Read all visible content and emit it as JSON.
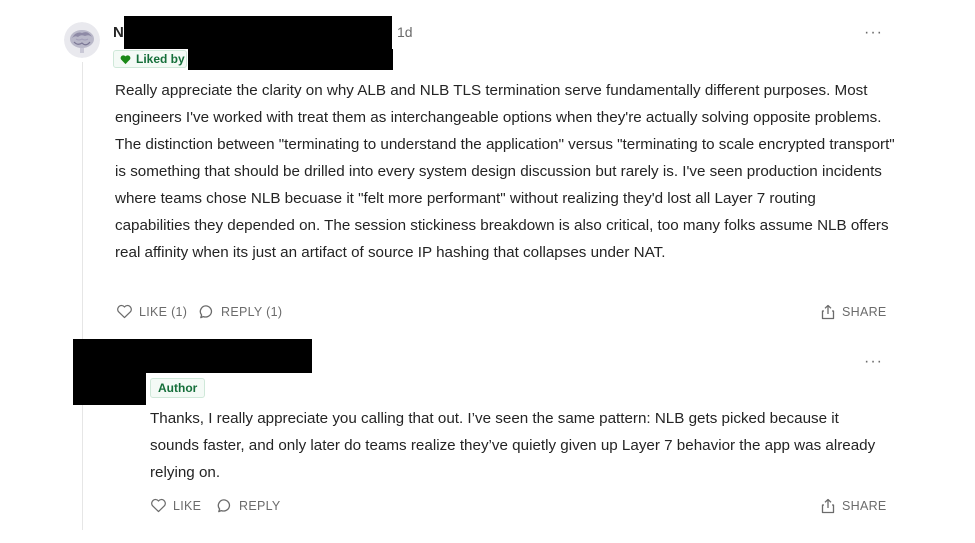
{
  "comment": {
    "author_initial": "N",
    "timestamp": "1d",
    "more_label": "···",
    "liked_by_label": "Liked by",
    "body": "Really appreciate the clarity on why ALB and NLB TLS termination serve fundamentally different purposes. Most engineers I've worked with treat them as interchangeable options when they're actually solving opposite problems. The distinction between \"terminating to understand the application\" versus \"terminating to scale encrypted transport\" is something that should be drilled into every system design discussion but rarely is. I've seen production incidents where teams chose NLB becuase it \"felt more performant\" without realizing they'd lost all Layer 7 routing capabilities they depended on. The session stickiness breakdown is also critical, too many folks assume NLB offers real affinity when its just an artifact of source IP hashing that collapses under NAT.",
    "like_label": "LIKE (1)",
    "reply_label": "REPLY (1)",
    "share_label": "SHARE"
  },
  "reply": {
    "more_label": "···",
    "author_badge": "Author",
    "body": "Thanks, I really appreciate you calling that out. I’ve seen the same pattern: NLB gets picked because it sounds faster, and only later do teams realize they’ve quietly given up Layer 7 behavior the app was already relying on.",
    "like_label": "LIKE",
    "reply_label": "REPLY",
    "share_label": "SHARE"
  },
  "colors": {
    "text": "#242424",
    "muted": "#6b6b6b",
    "badge_green": "#156f3a",
    "badge_bg": "#f4faf6"
  },
  "icons": [
    "heart-icon",
    "like-heart-icon",
    "reply-bubble-icon",
    "share-icon",
    "more-dots-icon"
  ]
}
